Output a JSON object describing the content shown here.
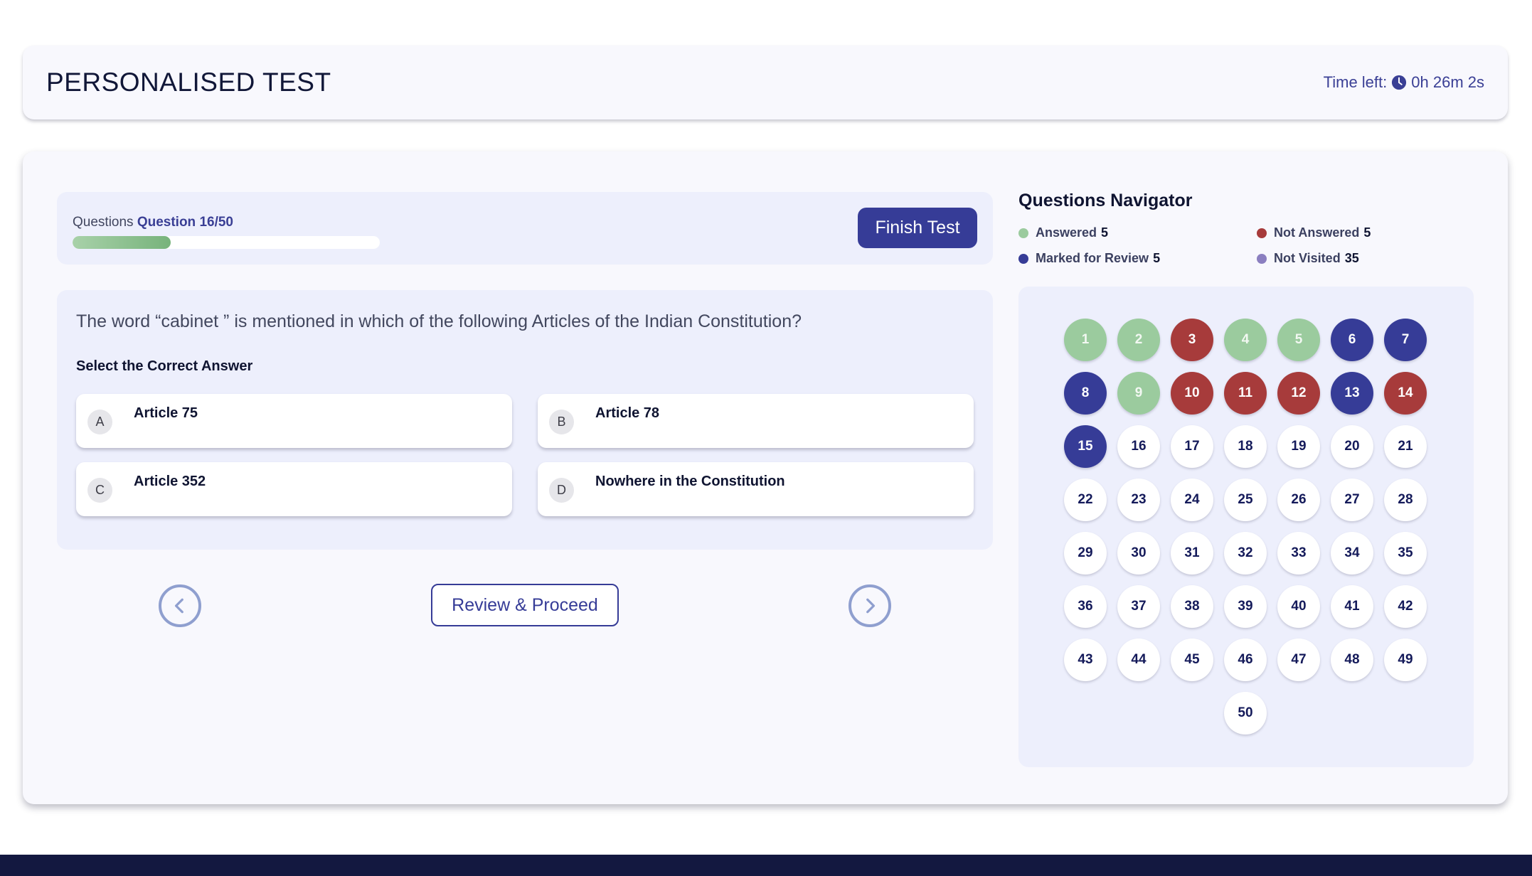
{
  "header": {
    "title": "PERSONALISED TEST",
    "time_label": "Time left:",
    "time_value": "0h 26m 2s"
  },
  "progress": {
    "label": "Questions",
    "current": "Question 16/50",
    "fraction": 0.32,
    "finish_label": "Finish Test"
  },
  "question": {
    "text": "The word “cabinet ” is mentioned in which of the following Articles of the Indian Constitution?",
    "select_label": "Select the Correct Answer",
    "options": [
      {
        "letter": "A",
        "text": "Article 75"
      },
      {
        "letter": "B",
        "text": "Article 78"
      },
      {
        "letter": "C",
        "text": "Article 352"
      },
      {
        "letter": "D",
        "text": "Nowhere in the Constitution"
      }
    ]
  },
  "controls": {
    "review_label": "Review & Proceed",
    "prev_icon": "chevron-left-icon",
    "next_icon": "chevron-right-icon"
  },
  "navigator": {
    "title": "Questions Navigator",
    "legend": [
      {
        "label": "Answered",
        "count": "5",
        "color": "#9bcb9e"
      },
      {
        "label": "Not Answered",
        "count": "5",
        "color": "#a73b3b"
      },
      {
        "label": "Marked for Review",
        "count": "5",
        "color": "#363c97"
      },
      {
        "label": "Not Visited",
        "count": "35",
        "color": "#8b7fc0"
      }
    ],
    "status_colors": {
      "answered": "#9bcb9e",
      "not_answered": "#a73b3b",
      "marked": "#363c97",
      "not_visited": "#ffffff"
    },
    "questions": [
      {
        "n": "1",
        "status": "answered"
      },
      {
        "n": "2",
        "status": "answered"
      },
      {
        "n": "3",
        "status": "not_answered"
      },
      {
        "n": "4",
        "status": "answered"
      },
      {
        "n": "5",
        "status": "answered"
      },
      {
        "n": "6",
        "status": "marked"
      },
      {
        "n": "7",
        "status": "marked"
      },
      {
        "n": "8",
        "status": "marked"
      },
      {
        "n": "9",
        "status": "answered"
      },
      {
        "n": "10",
        "status": "not_answered"
      },
      {
        "n": "11",
        "status": "not_answered"
      },
      {
        "n": "12",
        "status": "not_answered"
      },
      {
        "n": "13",
        "status": "marked"
      },
      {
        "n": "14",
        "status": "not_answered"
      },
      {
        "n": "15",
        "status": "marked"
      },
      {
        "n": "16",
        "status": "not_visited"
      },
      {
        "n": "17",
        "status": "not_visited"
      },
      {
        "n": "18",
        "status": "not_visited"
      },
      {
        "n": "19",
        "status": "not_visited"
      },
      {
        "n": "20",
        "status": "not_visited"
      },
      {
        "n": "21",
        "status": "not_visited"
      },
      {
        "n": "22",
        "status": "not_visited"
      },
      {
        "n": "23",
        "status": "not_visited"
      },
      {
        "n": "24",
        "status": "not_visited"
      },
      {
        "n": "25",
        "status": "not_visited"
      },
      {
        "n": "26",
        "status": "not_visited"
      },
      {
        "n": "27",
        "status": "not_visited"
      },
      {
        "n": "28",
        "status": "not_visited"
      },
      {
        "n": "29",
        "status": "not_visited"
      },
      {
        "n": "30",
        "status": "not_visited"
      },
      {
        "n": "31",
        "status": "not_visited"
      },
      {
        "n": "32",
        "status": "not_visited"
      },
      {
        "n": "33",
        "status": "not_visited"
      },
      {
        "n": "34",
        "status": "not_visited"
      },
      {
        "n": "35",
        "status": "not_visited"
      },
      {
        "n": "36",
        "status": "not_visited"
      },
      {
        "n": "37",
        "status": "not_visited"
      },
      {
        "n": "38",
        "status": "not_visited"
      },
      {
        "n": "39",
        "status": "not_visited"
      },
      {
        "n": "40",
        "status": "not_visited"
      },
      {
        "n": "41",
        "status": "not_visited"
      },
      {
        "n": "42",
        "status": "not_visited"
      },
      {
        "n": "43",
        "status": "not_visited"
      },
      {
        "n": "44",
        "status": "not_visited"
      },
      {
        "n": "45",
        "status": "not_visited"
      },
      {
        "n": "46",
        "status": "not_visited"
      },
      {
        "n": "47",
        "status": "not_visited"
      },
      {
        "n": "48",
        "status": "not_visited"
      },
      {
        "n": "49",
        "status": "not_visited"
      },
      {
        "n": "50",
        "status": "not_visited"
      }
    ]
  }
}
